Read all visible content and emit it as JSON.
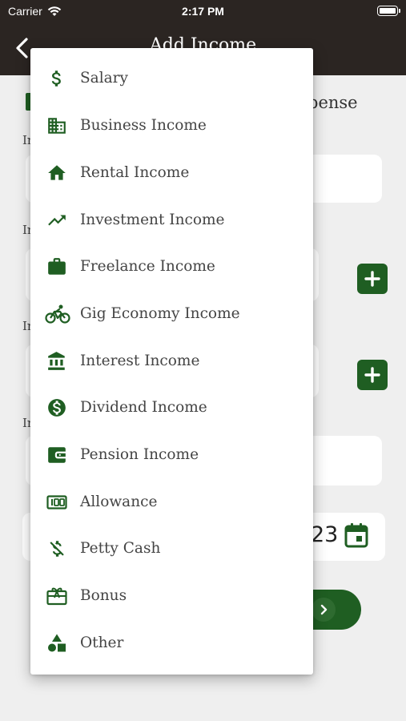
{
  "status_bar": {
    "carrier": "Carrier",
    "time": "2:17 PM"
  },
  "app_bar": {
    "title": "Add Income"
  },
  "background_form": {
    "expense_tab_label": "pense",
    "label_1": "In",
    "label_2": "In",
    "label_3": "In",
    "label_4": "In",
    "date_value_fragment": "23"
  },
  "theme": {
    "primary": "#1f5e22",
    "header": "#2b2522"
  },
  "income_categories": [
    {
      "label": "Salary",
      "icon": "dollar-icon"
    },
    {
      "label": "Business Income",
      "icon": "building-icon"
    },
    {
      "label": "Rental Income",
      "icon": "home-icon"
    },
    {
      "label": "Investment Income",
      "icon": "trending-up-icon"
    },
    {
      "label": "Freelance Income",
      "icon": "briefcase-icon"
    },
    {
      "label": "Gig Economy Income",
      "icon": "bicycle-icon"
    },
    {
      "label": "Interest Income",
      "icon": "bank-icon"
    },
    {
      "label": "Dividend Income",
      "icon": "dollar-circle-icon"
    },
    {
      "label": "Pension Income",
      "icon": "wallet-icon"
    },
    {
      "label": "Allowance",
      "icon": "banknote-icon"
    },
    {
      "label": "Petty Cash",
      "icon": "dollar-off-icon"
    },
    {
      "label": "Bonus",
      "icon": "gift-card-icon"
    },
    {
      "label": "Other",
      "icon": "shapes-icon"
    }
  ]
}
